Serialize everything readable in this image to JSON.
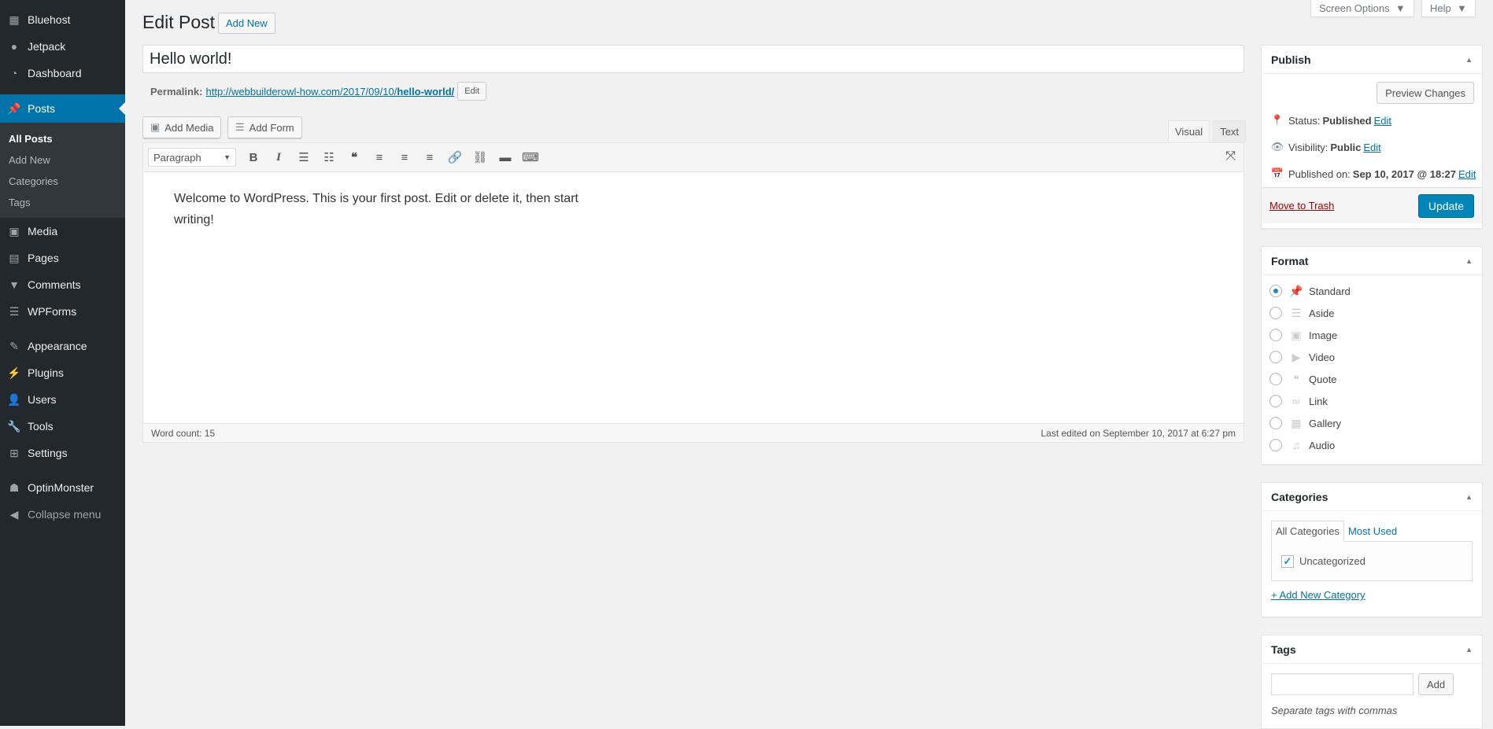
{
  "sidebar": {
    "items": [
      {
        "label": "Bluehost",
        "icon": "grid-icon"
      },
      {
        "label": "Jetpack",
        "icon": "jetpack-icon"
      },
      {
        "label": "Dashboard",
        "icon": "dashboard-icon"
      },
      {
        "label": "Posts",
        "icon": "pin-icon",
        "active": true
      },
      {
        "label": "Media",
        "icon": "media-icon"
      },
      {
        "label": "Pages",
        "icon": "pages-icon"
      },
      {
        "label": "Comments",
        "icon": "comment-icon"
      },
      {
        "label": "WPForms",
        "icon": "form-icon"
      },
      {
        "label": "Appearance",
        "icon": "brush-icon"
      },
      {
        "label": "Plugins",
        "icon": "plugin-icon"
      },
      {
        "label": "Users",
        "icon": "user-icon"
      },
      {
        "label": "Tools",
        "icon": "wrench-icon"
      },
      {
        "label": "Settings",
        "icon": "settings-icon"
      },
      {
        "label": "OptinMonster",
        "icon": "monster-icon"
      }
    ],
    "posts_submenu": [
      "All Posts",
      "Add New",
      "Categories",
      "Tags"
    ],
    "collapse_label": "Collapse menu"
  },
  "header": {
    "screen_options": "Screen Options",
    "help": "Help",
    "title": "Edit Post",
    "add_new": "Add New"
  },
  "post": {
    "title": "Hello world!",
    "permalink_label": "Permalink:",
    "permalink_base": "http://webbuilderowl-how.com/2017/09/10/",
    "permalink_slug": "hello-world/",
    "permalink_edit": "Edit"
  },
  "editor": {
    "add_media": "Add Media",
    "add_form": "Add Form",
    "tab_visual": "Visual",
    "tab_text": "Text",
    "format_select": "Paragraph",
    "content": "Welcome to WordPress. This is your first post. Edit or delete it, then start writing!",
    "word_count": "Word count: 15",
    "last_edited": "Last edited on September 10, 2017 at 6:27 pm"
  },
  "publish": {
    "title": "Publish",
    "preview": "Preview Changes",
    "status_label": "Status:",
    "status_value": "Published",
    "visibility_label": "Visibility:",
    "visibility_value": "Public",
    "published_label": "Published on:",
    "published_value": "Sep 10, 2017 @ 18:27",
    "edit": "Edit",
    "trash": "Move to Trash",
    "update": "Update"
  },
  "format": {
    "title": "Format",
    "options": [
      "Standard",
      "Aside",
      "Image",
      "Video",
      "Quote",
      "Link",
      "Gallery",
      "Audio"
    ],
    "selected": "Standard"
  },
  "categories": {
    "title": "Categories",
    "tab_all": "All Categories",
    "tab_most": "Most Used",
    "items": [
      {
        "label": "Uncategorized",
        "checked": true
      }
    ],
    "add_new": "+ Add New Category"
  },
  "tags": {
    "title": "Tags",
    "input_value": "",
    "add": "Add",
    "hint": "Separate tags with commas"
  }
}
